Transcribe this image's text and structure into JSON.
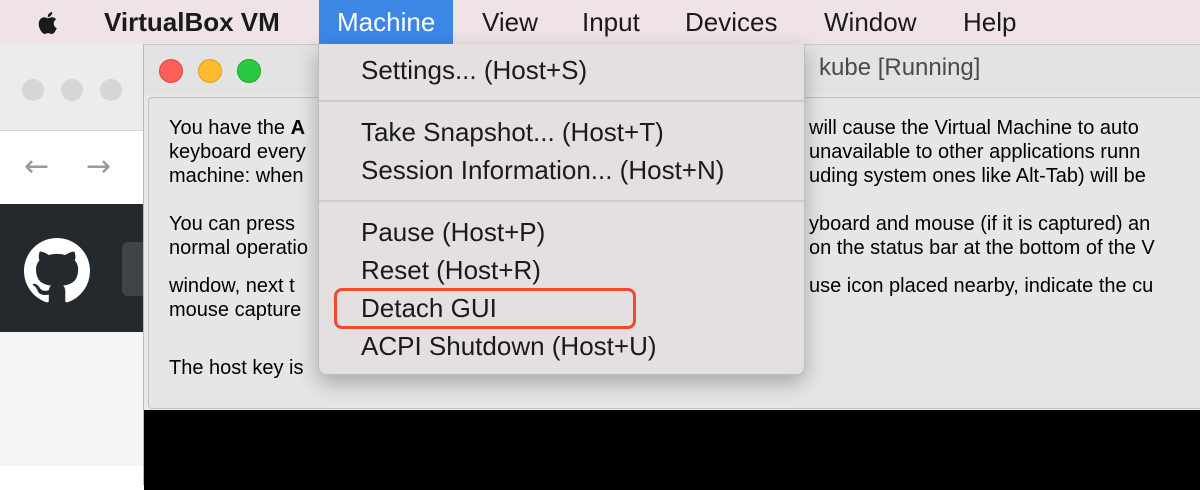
{
  "menubar": {
    "app_name": "VirtualBox VM",
    "items": [
      "Machine",
      "View",
      "Input",
      "Devices",
      "Window",
      "Help"
    ],
    "active_item": "Machine"
  },
  "browser": {
    "back_arrow": "←",
    "forward_arrow": "→"
  },
  "vm_window": {
    "title_fragment": "kube [Running]",
    "lines": [
      "You have the ",
      "A",
      "will cause the Virtual Machine to auto",
      "keyboard every",
      "unavailable to other applications runn",
      "machine: when",
      "uding system ones like Alt-Tab) will be",
      "You can press",
      "yboard and mouse (if it is captured) an",
      "normal operatio",
      "on the status bar at the bottom of the V",
      "window, next t",
      "use icon placed nearby, indicate the cu",
      "mouse capture",
      "The host key is"
    ]
  },
  "machine_menu": {
    "groups": [
      [
        "Settings... (Host+S)"
      ],
      [
        "Take Snapshot... (Host+T)",
        "Session Information... (Host+N)"
      ],
      [
        "Pause (Host+P)",
        "Reset (Host+R)",
        "Detach GUI",
        "ACPI Shutdown (Host+U)"
      ]
    ],
    "highlighted_item": "Detach GUI",
    "highlight_color": "#f0492e"
  },
  "colors": {
    "menubar_bg": "#efe3e7",
    "active_menu_bg": "#3c87e6",
    "github_bar": "#24292e"
  }
}
